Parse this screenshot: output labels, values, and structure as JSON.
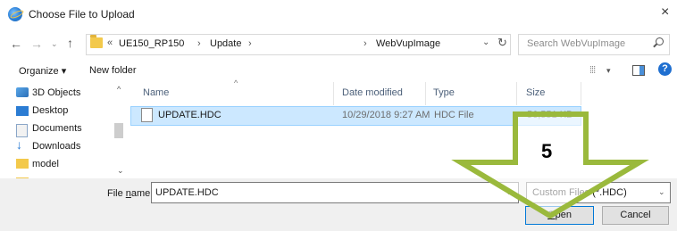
{
  "window": {
    "title": "Choose File to Upload",
    "close_glyph": "×"
  },
  "nav": {
    "back_glyph": "←",
    "forward_glyph": "→",
    "recent_glyph": "⌄",
    "up_glyph": "↑",
    "address": {
      "overflow": "«",
      "crumbs": [
        "UE150_RP150",
        "Update",
        "WebVupImage"
      ],
      "separator": "›",
      "dropdown_glyph": "⌄",
      "refresh_glyph": "↻"
    },
    "search_placeholder": "Search WebVupImage"
  },
  "toolbar": {
    "organize_label": "Organize ▾",
    "new_folder_label": "New folder",
    "view_glyph": "⁞⁞⁞",
    "view_drop_glyph": "▾",
    "help_label": "?"
  },
  "sidebar": {
    "items": [
      {
        "label": "3D Objects",
        "icon": "3d-objects-icon"
      },
      {
        "label": "Desktop",
        "icon": "desktop-icon"
      },
      {
        "label": "Documents",
        "icon": "documents-icon"
      },
      {
        "label": "Downloads",
        "icon": "downloads-icon"
      },
      {
        "label": "model",
        "icon": "folder-icon"
      }
    ],
    "scroll_up_glyph": "^",
    "scroll_down_glyph": "⌄"
  },
  "file_list": {
    "sort_glyph": "^",
    "columns": [
      "Name",
      "Date modified",
      "Type",
      "Size"
    ],
    "rows": [
      {
        "name": "UPDATE.HDC",
        "date": "10/29/2018 9:27 AM",
        "type": "HDC File",
        "size": "56,551 KB",
        "selected": true
      }
    ]
  },
  "footer": {
    "file_name_label": "File name:",
    "file_name_value": "UPDATE.HDC",
    "file_type_value": "Custom Files (*.HDC)",
    "dropdown_glyph": "⌄",
    "open_label": "Open",
    "cancel_label": "Cancel"
  },
  "annotation": {
    "step_number": "5",
    "arrow_color": "#9ab93c"
  }
}
